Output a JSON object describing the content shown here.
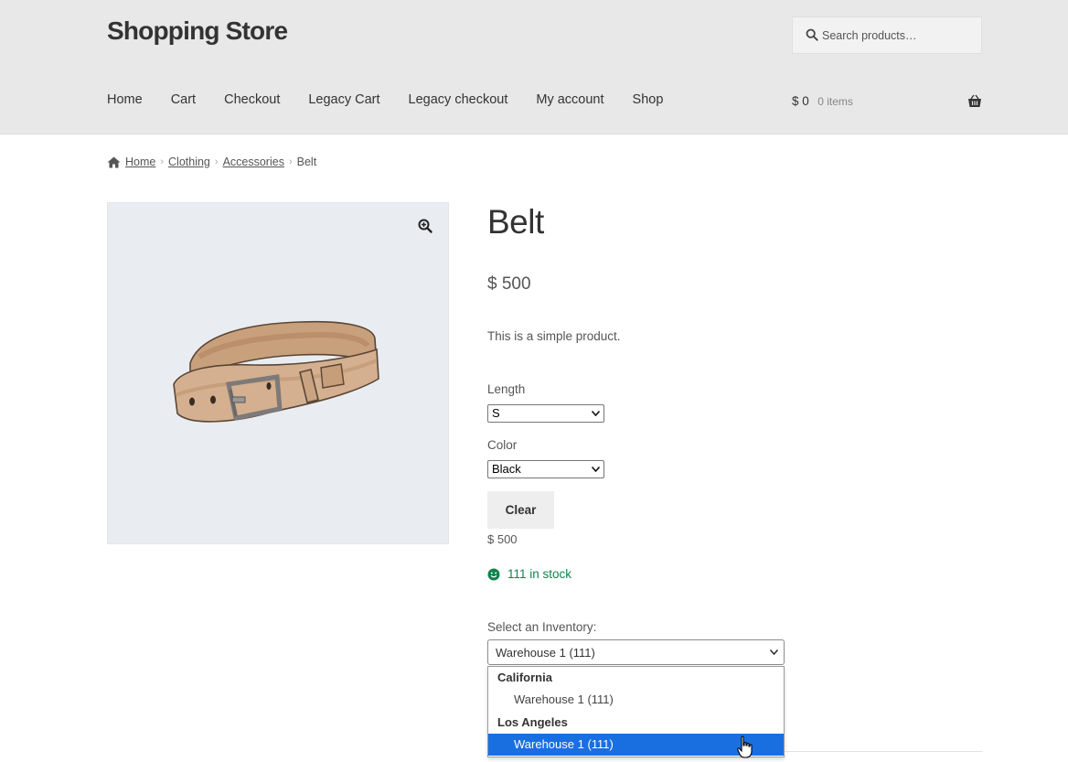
{
  "site": {
    "title": "Shopping Store"
  },
  "search": {
    "placeholder": "Search products…",
    "icon": "search-icon"
  },
  "nav": {
    "items": [
      "Home",
      "Cart",
      "Checkout",
      "Legacy Cart",
      "Legacy checkout",
      "My account",
      "Shop"
    ]
  },
  "cart": {
    "total": "$ 0",
    "count": "0 items",
    "icon": "basket-icon"
  },
  "breadcrumb": {
    "items": [
      "Home",
      "Clothing",
      "Accessories"
    ],
    "current": "Belt",
    "separator": "›"
  },
  "product": {
    "title": "Belt",
    "price": "$ 500",
    "short_description": "This is a simple product.",
    "image_alt": "Belt",
    "zoom_icon": "zoom-in-icon"
  },
  "variations": {
    "length_label": "Length",
    "length_value": "S",
    "color_label": "Color",
    "color_value": "Black",
    "clear_label": "Clear",
    "price": "$ 500"
  },
  "stock": {
    "text": "111 in stock",
    "icon": "smile-icon",
    "color": "#0f834d"
  },
  "inventory": {
    "label": "Select an Inventory:",
    "selected": "Warehouse 1 (111)",
    "groups": [
      {
        "name": "California",
        "options": [
          "Warehouse 1 (111)"
        ]
      },
      {
        "name": "Los Angeles",
        "options": [
          "Warehouse 1 (111)"
        ]
      }
    ],
    "highlight_color": "#1a6fe0"
  }
}
